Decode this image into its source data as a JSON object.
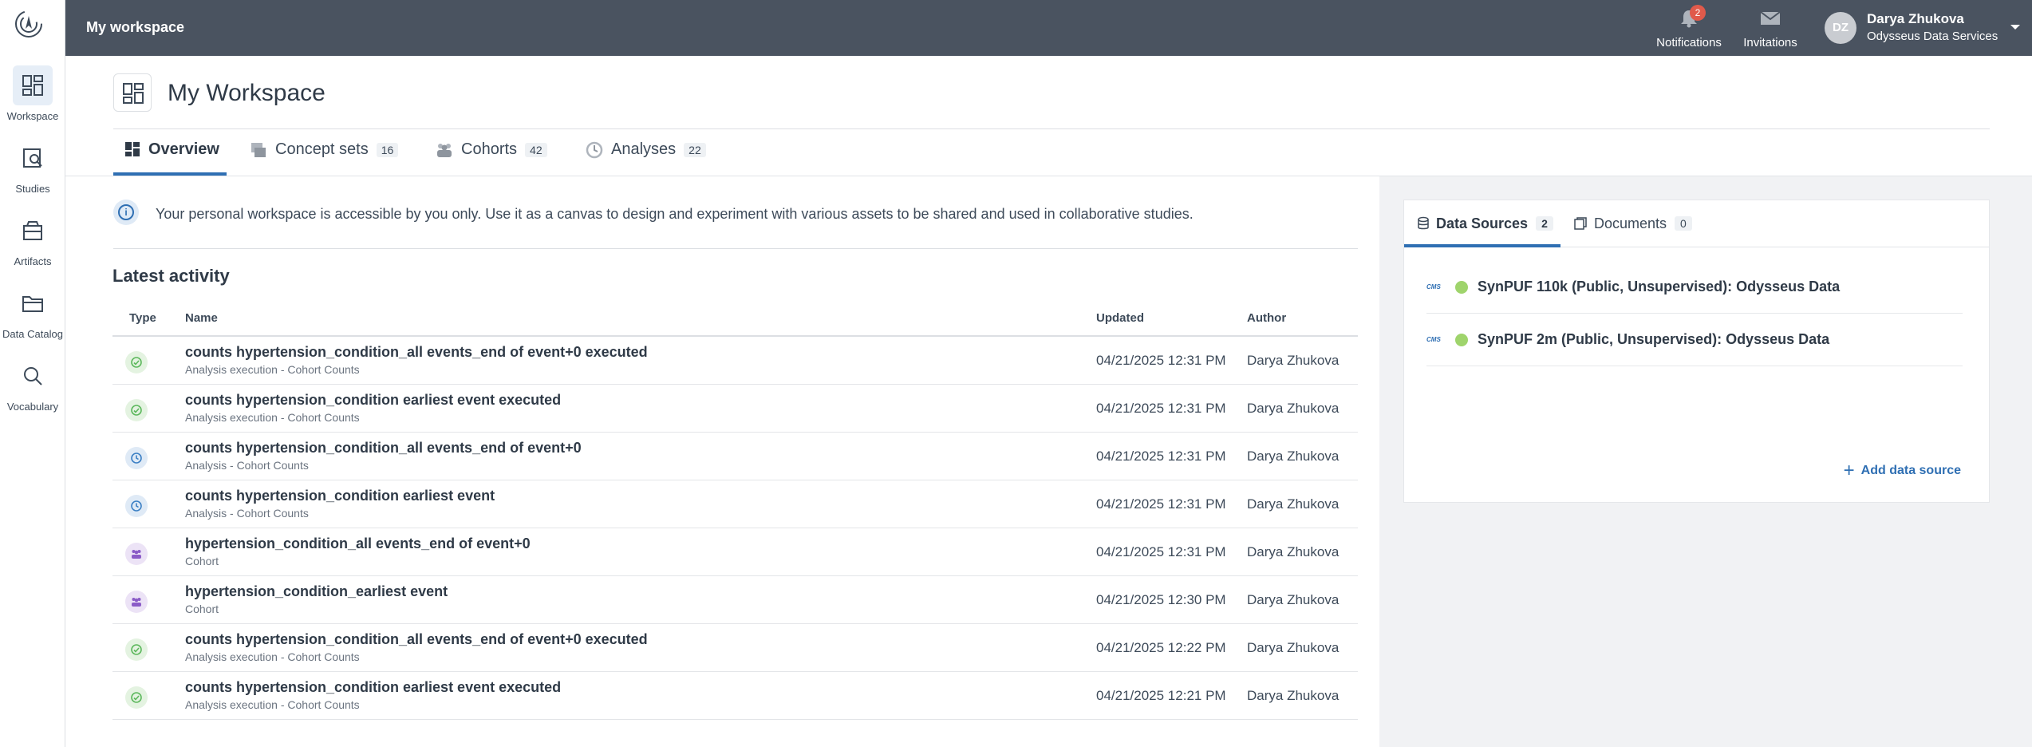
{
  "topbar": {
    "title": "My workspace",
    "notifications": {
      "label": "Notifications",
      "badge": "2"
    },
    "invitations": {
      "label": "Invitations"
    },
    "user": {
      "initials": "DZ",
      "name": "Darya Zhukova",
      "org": "Odysseus Data Services"
    }
  },
  "rail": {
    "items": [
      {
        "label": "Workspace",
        "icon": "workspace-icon"
      },
      {
        "label": "Studies",
        "icon": "studies-icon"
      },
      {
        "label": "Artifacts",
        "icon": "artifacts-icon"
      },
      {
        "label": "Data Catalog",
        "icon": "folder-icon"
      },
      {
        "label": "Vocabulary",
        "icon": "search-icon"
      }
    ]
  },
  "page": {
    "title": "My Workspace"
  },
  "tabs": [
    {
      "label": "Overview",
      "count": null
    },
    {
      "label": "Concept sets",
      "count": "16"
    },
    {
      "label": "Cohorts",
      "count": "42"
    },
    {
      "label": "Analyses",
      "count": "22"
    }
  ],
  "info": {
    "text": "Your personal workspace is accessible by you only. Use it as a canvas to design and experiment with various assets to be shared and used in collaborative studies."
  },
  "activity": {
    "title": "Latest activity",
    "columns": {
      "type": "Type",
      "name": "Name",
      "updated": "Updated",
      "author": "Author"
    },
    "rows": [
      {
        "name": "counts hypertension_condition_all events_end of event+0 executed",
        "sub": "Analysis execution - Cohort Counts",
        "updated": "04/21/2025 12:31 PM",
        "author": "Darya Zhukova",
        "kind": "green"
      },
      {
        "name": "counts hypertension_condition earliest event executed",
        "sub": "Analysis execution - Cohort Counts",
        "updated": "04/21/2025 12:31 PM",
        "author": "Darya Zhukova",
        "kind": "green"
      },
      {
        "name": "counts hypertension_condition_all events_end of event+0",
        "sub": "Analysis - Cohort Counts",
        "updated": "04/21/2025 12:31 PM",
        "author": "Darya Zhukova",
        "kind": "blue"
      },
      {
        "name": "counts hypertension_condition earliest event",
        "sub": "Analysis - Cohort Counts",
        "updated": "04/21/2025 12:31 PM",
        "author": "Darya Zhukova",
        "kind": "blue"
      },
      {
        "name": "hypertension_condition_all events_end of event+0",
        "sub": "Cohort",
        "updated": "04/21/2025 12:31 PM",
        "author": "Darya Zhukova",
        "kind": "purple"
      },
      {
        "name": "hypertension_condition_earliest event",
        "sub": "Cohort",
        "updated": "04/21/2025 12:30 PM",
        "author": "Darya Zhukova",
        "kind": "purple"
      },
      {
        "name": "counts hypertension_condition_all events_end of event+0 executed",
        "sub": "Analysis execution - Cohort Counts",
        "updated": "04/21/2025 12:22 PM",
        "author": "Darya Zhukova",
        "kind": "green"
      },
      {
        "name": "counts hypertension_condition earliest event executed",
        "sub": "Analysis execution - Cohort Counts",
        "updated": "04/21/2025 12:21 PM",
        "author": "Darya Zhukova",
        "kind": "green"
      }
    ]
  },
  "datasources": {
    "tabs": [
      {
        "label": "Data Sources",
        "count": "2"
      },
      {
        "label": "Documents",
        "count": "0"
      }
    ],
    "items": [
      {
        "logo": "CMS",
        "name": "SynPUF 110k (Public, Unsupervised): Odysseus Data",
        "status_color": "#9fd46c"
      },
      {
        "logo": "CMS",
        "name": "SynPUF 2m (Public, Unsupervised): Odysseus Data",
        "status_color": "#9fd46c"
      }
    ],
    "add_label": "Add data source"
  },
  "colors": {
    "topbar": "#4a5360",
    "accent": "#2f6fb3",
    "ok": "#9fd46c"
  }
}
